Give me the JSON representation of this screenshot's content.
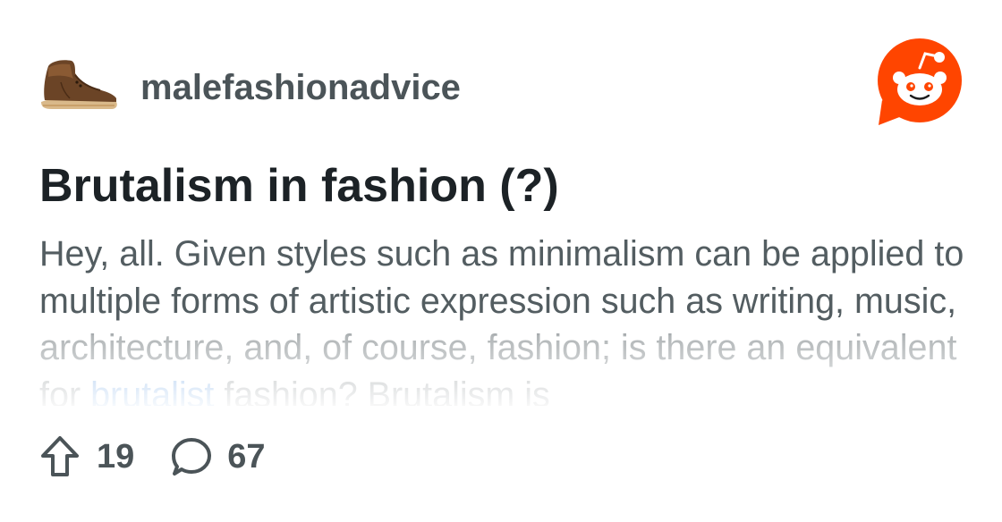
{
  "subreddit": {
    "name": "malefashionadvice",
    "icon": "desert-boot-icon"
  },
  "brand": {
    "icon": "reddit-snoo-logo",
    "color": "#ff4500"
  },
  "post": {
    "title": "Brutalism in fashion (?)",
    "body_segments": [
      "Hey, all. Given styles such as minimalism can be applied to multiple forms of artistic expression such as writing, music, architecture, and, of course, fashion; is there an equivalent for ",
      "brutalist",
      " fashion? Brutalism is"
    ],
    "link_color": "#2e7bd6"
  },
  "stats": {
    "upvotes": "19",
    "upvote_icon": "upvote-arrow-icon",
    "comments": "67",
    "comment_icon": "comment-bubble-icon"
  }
}
